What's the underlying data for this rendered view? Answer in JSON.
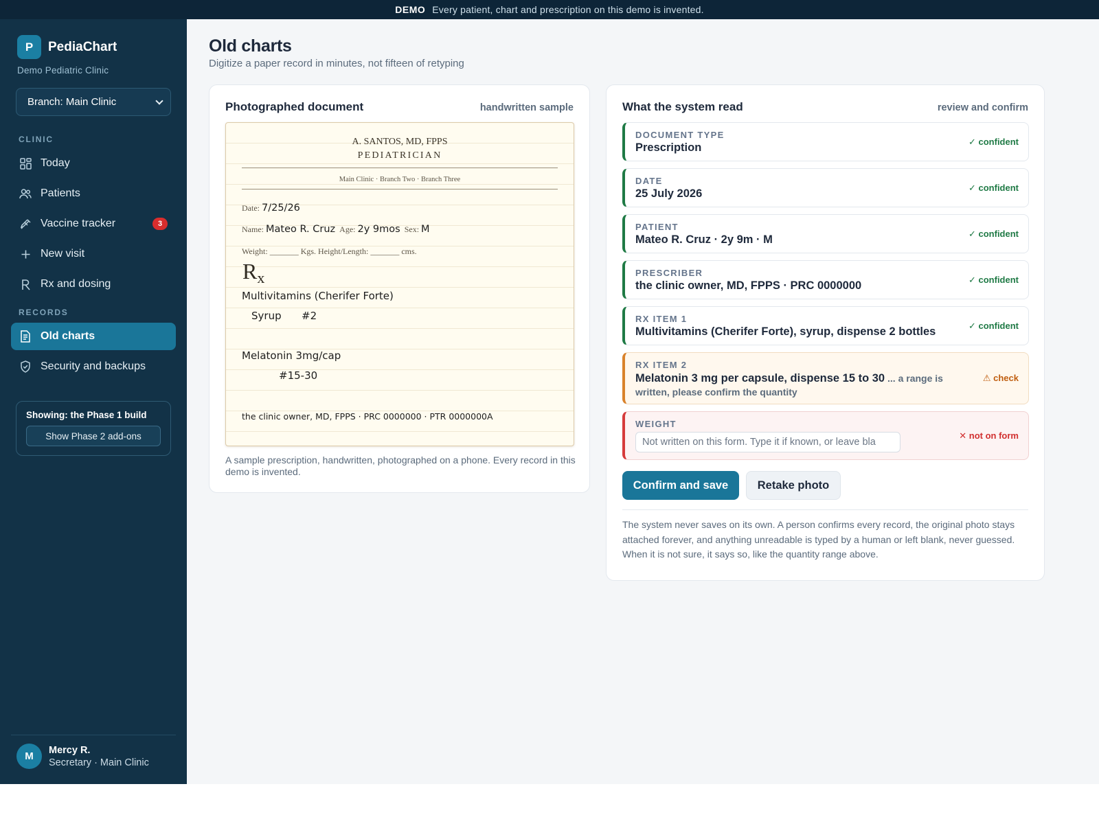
{
  "banner": {
    "tag": "DEMO",
    "text": "Every patient, chart and prescription on this demo is invented."
  },
  "brand": {
    "logo_letter": "P",
    "name": "PediaChart",
    "clinic": "Demo Pediatric Clinic"
  },
  "branch_select": {
    "value": "Branch: Main Clinic"
  },
  "sidebar": {
    "clinic_label": "CLINIC",
    "records_label": "RECORDS",
    "items": [
      {
        "label": "Today",
        "icon": "grid-icon"
      },
      {
        "label": "Patients",
        "icon": "people-icon"
      },
      {
        "label": "Vaccine tracker",
        "icon": "syringe-icon",
        "badge": "3"
      },
      {
        "label": "New visit",
        "icon": "plus-icon"
      },
      {
        "label": "Rx and dosing",
        "icon": "rx-icon"
      },
      {
        "label": "Old charts",
        "icon": "document-icon",
        "active": true
      },
      {
        "label": "Security and backups",
        "icon": "shield-icon"
      }
    ],
    "phase": {
      "title": "Showing: the Phase 1 build",
      "button": "Show Phase 2 add-ons"
    },
    "user": {
      "initial": "M",
      "name": "Mercy R.",
      "role": "Secretary · Main Clinic"
    }
  },
  "main": {
    "title": "Old charts",
    "subtitle": "Digitize a paper record in minutes, not fifteen of retyping"
  },
  "document_card": {
    "title": "Photographed document",
    "tag": "handwritten sample",
    "paper": {
      "doctor": "A. SANTOS, MD, FPPS",
      "specialty": "PEDIATRICIAN",
      "branches": "Main Clinic · Branch Two · Branch Three",
      "date_label": "Date:",
      "date_value": "7/25/26",
      "name_label": "Name:",
      "name_value": "Mateo R. Cruz",
      "age_label": "Age:",
      "age_value": "2y 9mos",
      "sex_label": "Sex:",
      "sex_value": "M",
      "weight_line": "Weight: _______ Kgs.  Height/Length: _______ cms.",
      "rx_symbol": "R",
      "rx_sub": "x",
      "item1": "Multivitamins (Cherifer Forte)",
      "item1_form": "Syrup",
      "item1_qty": "#2",
      "item2": "Melatonin 3mg/cap",
      "item2_qty": "#15-30",
      "signature": "the clinic owner, MD, FPPS · PRC 0000000 · PTR 0000000A"
    },
    "caption": "A sample prescription, handwritten, photographed on a phone. Every record in this demo is invented."
  },
  "read_card": {
    "title": "What the system read",
    "tag": "review and confirm",
    "fields": [
      {
        "label": "DOCUMENT TYPE",
        "value": "Prescription",
        "status": "✓ confident"
      },
      {
        "label": "DATE",
        "value": "25 July 2026",
        "status": "✓ confident"
      },
      {
        "label": "PATIENT",
        "value": "Mateo R. Cruz · 2y 9m · M",
        "status": "✓ confident"
      },
      {
        "label": "PRESCRIBER",
        "value": "the clinic owner, MD, FPPS · PRC 0000000",
        "status": "✓ confident"
      },
      {
        "label": "RX ITEM 1",
        "value": "Multivitamins (Cherifer Forte), syrup, dispense 2 bottles",
        "status": "✓ confident"
      },
      {
        "label": "RX ITEM 2",
        "value": "Melatonin 3 mg per capsule, dispense 15 to 30",
        "note": " ... a range is written, please confirm the quantity",
        "status": "⚠ check"
      },
      {
        "label": "WEIGHT",
        "placeholder": "Not written on this form. Type it if known, or leave bla",
        "status": "✕ not on form"
      }
    ],
    "confirm_button": "Confirm and save",
    "retake_button": "Retake photo",
    "footnote": "The system never saves on its own. A person confirms every record, the original photo stays attached forever, and anything unreadable is typed by a human or left blank, never guessed. When it is not sure, it says so, like the quantity range above."
  }
}
